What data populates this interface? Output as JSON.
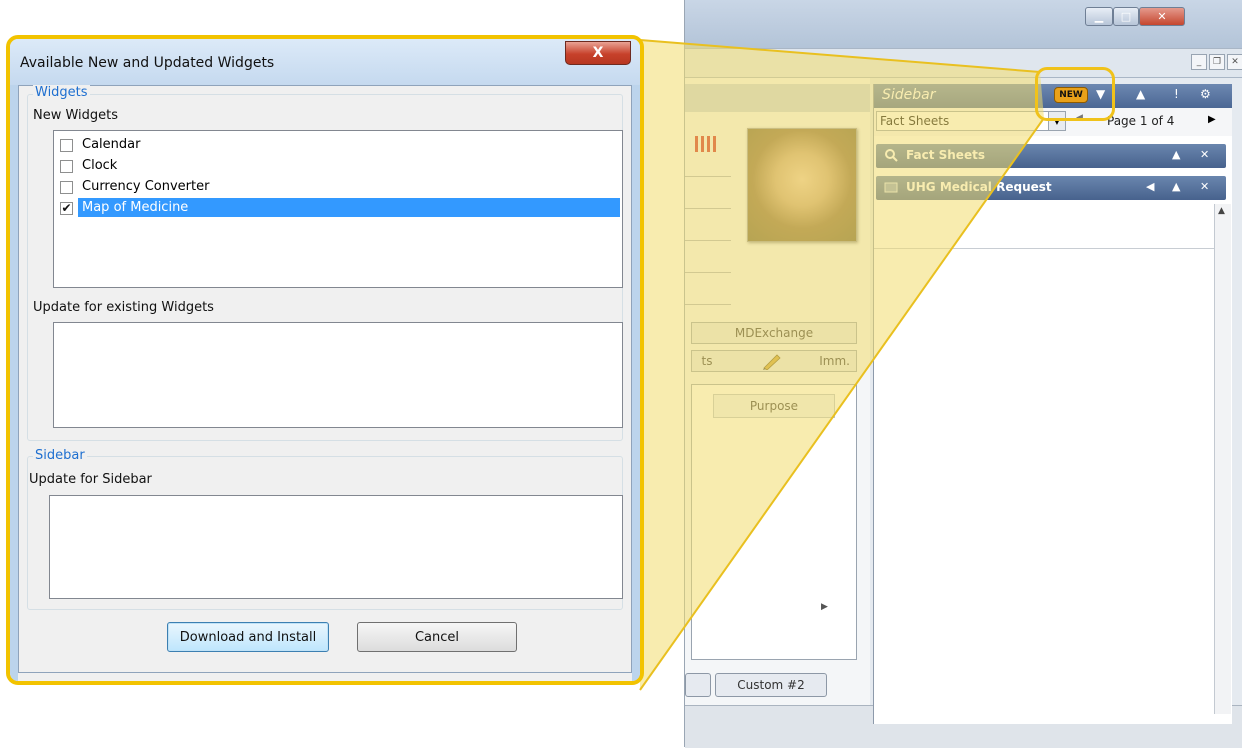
{
  "dialog": {
    "title": "Available New and Updated Widgets",
    "close_glyph": "X",
    "widgets_group": {
      "legend": "Widgets",
      "new_label": "New Widgets",
      "new_items": [
        {
          "label": "Calendar",
          "checked": false,
          "check": ""
        },
        {
          "label": "Clock",
          "checked": false,
          "check": ""
        },
        {
          "label": "Currency Converter",
          "checked": false,
          "check": ""
        },
        {
          "label": "Map of Medicine",
          "checked": true,
          "check": "✔"
        }
      ],
      "update_label": "Update for existing Widgets"
    },
    "sidebar_group": {
      "legend": "Sidebar",
      "update_label": "Update for Sidebar"
    },
    "buttons": {
      "download_install": "Download and Install",
      "cancel": "Cancel"
    }
  },
  "background_app": {
    "tab_mdexchange": "MDExchange",
    "tab_left_fragment": "ts",
    "tab_imm": "Imm.",
    "grid_column": "Purpose",
    "bottom_tab": "Custom #2",
    "sidebar": {
      "title": "Sidebar",
      "new_badge": "NEW",
      "selector_value": "Fact Sheets",
      "page_text": "Page 1 of 4",
      "sections": [
        {
          "label": "Fact Sheets"
        },
        {
          "label": "UHG Medical Request"
        }
      ]
    }
  },
  "colors": {
    "callout_yellow": "#f2c300",
    "legend_blue": "#1e6fd0",
    "selection_blue": "#3399ff",
    "sidebar_header": "#4b6794",
    "new_badge": "#e9a11a"
  }
}
